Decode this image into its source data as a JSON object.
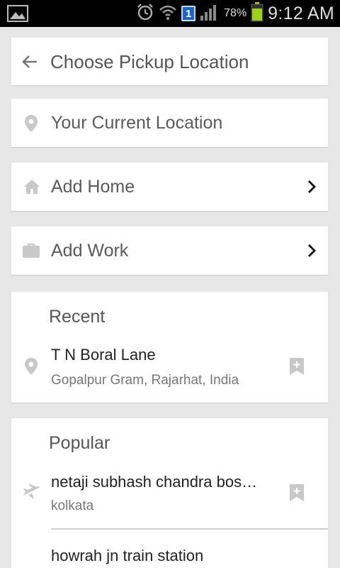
{
  "status_bar": {
    "battery_percent": "78%",
    "time": "9:12 AM",
    "notification_count": "1",
    "colors": {
      "background": "#000000",
      "battery": "#9bd11e",
      "badge": "#1e63c9"
    }
  },
  "header": {
    "title": "Choose Pickup Location"
  },
  "options": {
    "current_location": "Your Current Location",
    "add_home": "Add Home",
    "add_work": "Add Work"
  },
  "recent": {
    "title": "Recent",
    "items": [
      {
        "name": "T N Boral Lane",
        "subtitle": "Gopalpur Gram, Rajarhat, India"
      }
    ]
  },
  "popular": {
    "title": "Popular",
    "items": [
      {
        "name": "netaji subhash chandra bos…",
        "subtitle": "kolkata"
      },
      {
        "name": "howrah jn train station",
        "subtitle": ""
      }
    ]
  },
  "icons": [
    "gallery-icon",
    "alarm-icon",
    "wifi-icon",
    "signal-icon",
    "battery-icon",
    "back-arrow-icon",
    "location-pin-icon",
    "home-icon",
    "briefcase-icon",
    "chevron-right-icon",
    "bookmark-add-icon",
    "airplane-icon"
  ]
}
